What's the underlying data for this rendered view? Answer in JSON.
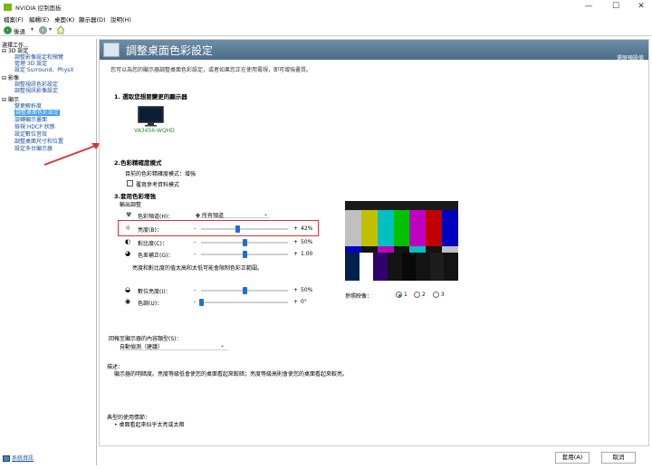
{
  "window": {
    "title": "NVIDIA 控制面板",
    "minimize": "—",
    "maximize": "☐",
    "close": "✕"
  },
  "menu": [
    "檔案(F)",
    "編輯(E)",
    "桌面(K)",
    "顯示器(D)",
    "說明(H)"
  ],
  "toolbar": {
    "back_label": "後退",
    "back_icon": "back-arrow-icon",
    "forward_icon": "forward-arrow-icon",
    "home_icon": "home-icon"
  },
  "left_pane": {
    "heading": "選擇工作...",
    "groups": [
      {
        "label": "3D 設定",
        "items": [
          "調整影像設定和預覽",
          "管理 3D 設定",
          "設定 Surround、PhysX"
        ]
      },
      {
        "label": "影像",
        "items": [
          "調整視訊色彩設定",
          "調整視訊影像設定"
        ]
      },
      {
        "label": "顯示",
        "items": [
          "變更解析度",
          "調整桌面色彩設定",
          "旋轉顯示畫面",
          "檢視 HDCP 狀態",
          "設定數位音效",
          "調整桌面尺寸和位置",
          "設定多台顯示器"
        ]
      }
    ],
    "selected": "調整桌面色彩設定",
    "system_info": "系統資訊"
  },
  "page": {
    "title": "調整桌面色彩設定",
    "restore_defaults": "還原預設值",
    "intro": "您可以為您的顯示器調整桌面色彩設定，或者如果您正在使用電視，即可增強畫質。",
    "section1": "1. 選取您想要變更的顯示器",
    "monitor_name": "VA3456-WQHD",
    "section2": "2.色彩精確度模式",
    "current_mode": "目前的色彩精確度模式：增強",
    "reference_mode": "覆寫參考資料模式",
    "section3": "3.套用色彩增強",
    "output_adjust": "輸出調整",
    "color_channel_label": "色彩頻道(H)：",
    "color_channel_value": "所有頻道",
    "sliders": [
      {
        "label": "亮度(B)：",
        "value_text": "42%",
        "value": 42
      },
      {
        "label": "對比度(C)：",
        "value_text": "50%",
        "value": 50
      },
      {
        "label": "色差補正(G)：",
        "value_text": "1.00",
        "value": 50
      }
    ],
    "note": "亮度和對比度的值太高和太低可能會限制色彩正範圍。",
    "sliders2": [
      {
        "label": "數位亮度(I)：",
        "value_text": "50%",
        "value": 50
      },
      {
        "label": "色調(U)：",
        "value_text": "0°",
        "value": 0
      }
    ],
    "reference_image_label": "參照映像：",
    "reference_options": [
      "1",
      "2",
      "3"
    ],
    "reference_selected": "1",
    "content_type_label": "回報至顯示器的內容類型(S)：",
    "content_type_value": "自動偵測（建議）",
    "description_label": "描述：",
    "description_text": "顯示器的明暗度。亮度等級低會使您的桌面看起來較暗；亮度等級高則會使您的桌面看起來較亮。",
    "usage_label": "典型的使用情節：",
    "usage_item": "桌面看起來似乎太亮或太暗",
    "apply_button": "套用(A)",
    "cancel_button": "取消"
  },
  "colors": {
    "nvidia_green": "#76b900",
    "banner": "#5a7a94",
    "selection": "#3399ff",
    "highlight_box": "#d0343a",
    "arrow": "#d6343a"
  },
  "test_pattern": {
    "top_bars": [
      "#c0c0c0",
      "#c0c000",
      "#00c0c0",
      "#00c000",
      "#c000c0",
      "#c00000",
      "#0000c0"
    ],
    "mid_bars": [
      "#0000c0",
      "#131313",
      "#c000c0",
      "#131313",
      "#00c0c0",
      "#131313",
      "#c0c0c0"
    ],
    "bottom_blocks": [
      "#00214c",
      "#ffffff",
      "#32006a",
      "#131313",
      "#090909",
      "#131313",
      "#1d1d1d",
      "#131313"
    ]
  }
}
